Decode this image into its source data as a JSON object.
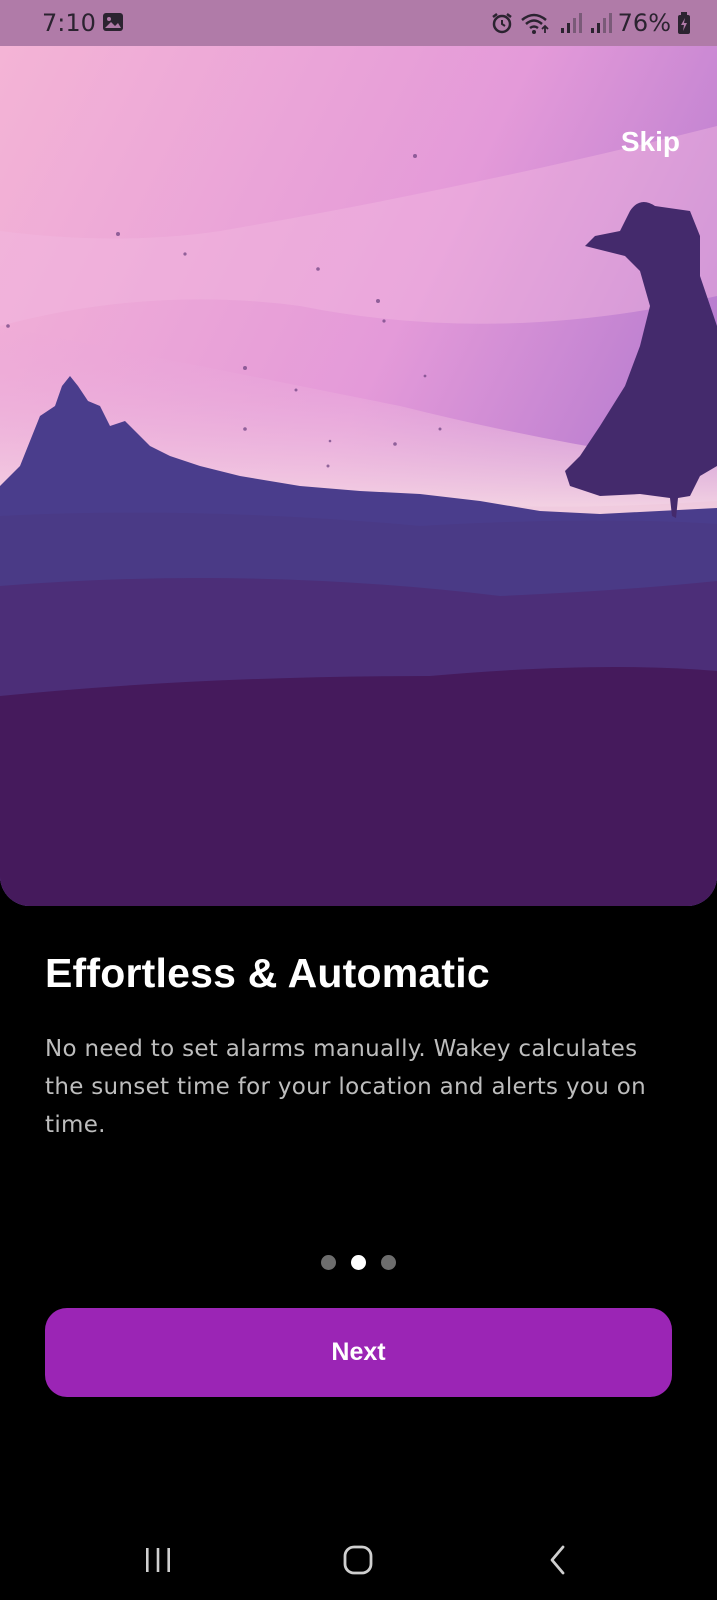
{
  "status_bar": {
    "time": "7:10",
    "battery_percent": "76%",
    "icons": [
      "gallery-icon",
      "alarm-icon",
      "wifi-icon",
      "signal-icon",
      "signal-icon",
      "battery-icon"
    ]
  },
  "onboarding": {
    "skip_label": "Skip",
    "title": "Effortless & Automatic",
    "description": "No need to set alarms manually. Wakey calculates the sunset time for your location and alerts you on time.",
    "page_indicator": {
      "total": 3,
      "current": 2
    },
    "next_label": "Next"
  },
  "nav_bar": {
    "icons": [
      "recent-apps-icon",
      "home-icon",
      "back-icon"
    ]
  },
  "colors": {
    "accent": "#9b25b5",
    "status_bar": "#b07ba8",
    "background": "#000000"
  }
}
